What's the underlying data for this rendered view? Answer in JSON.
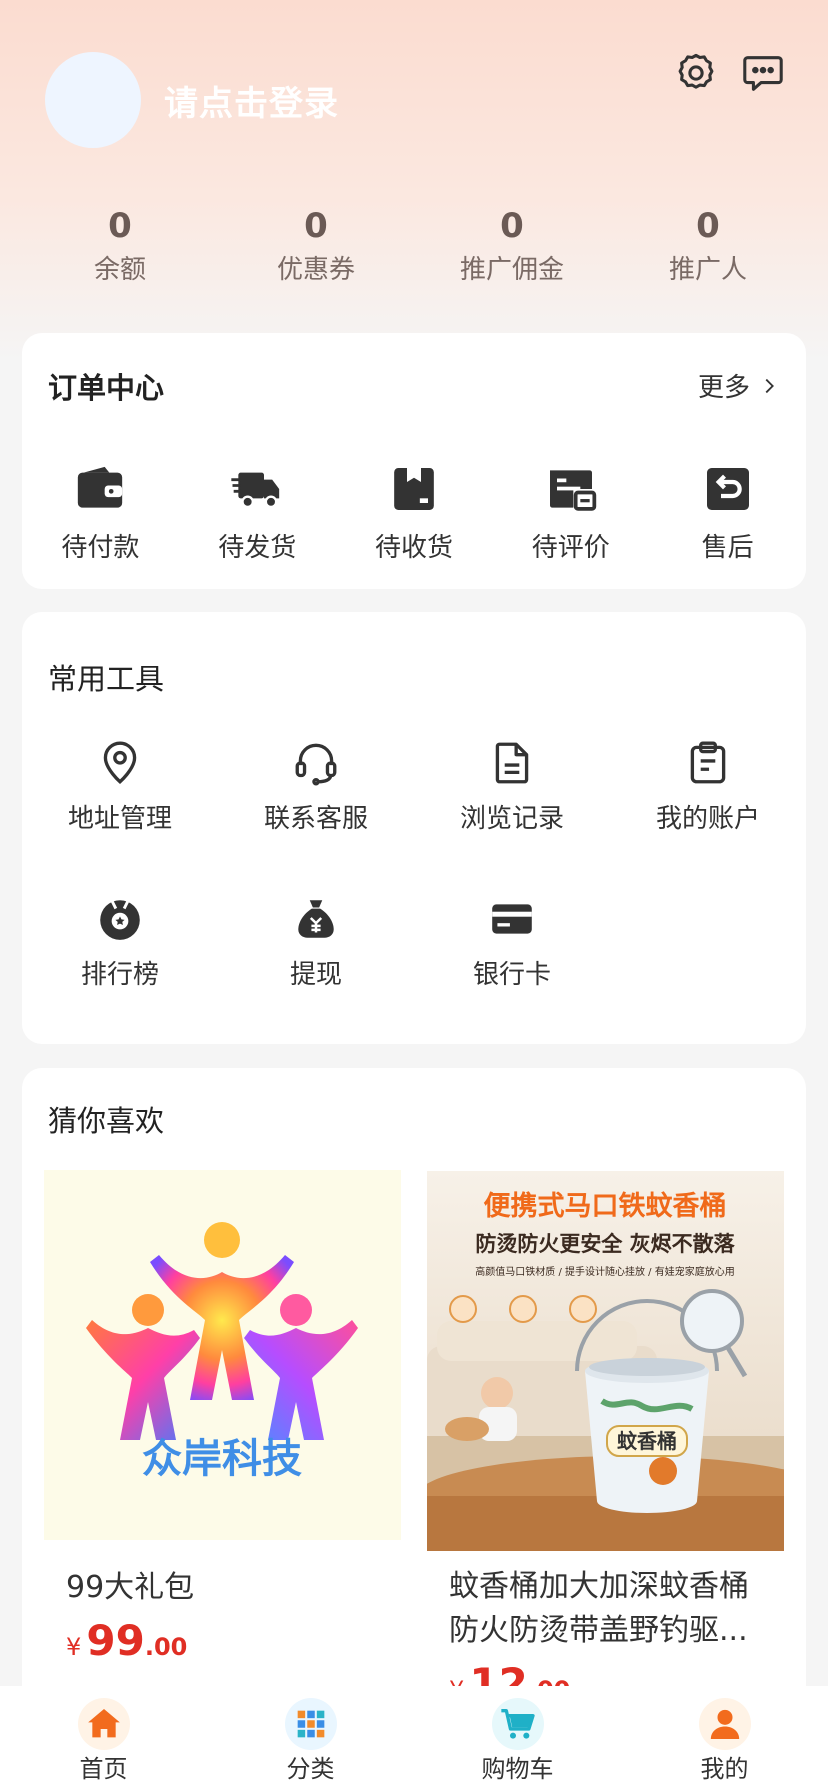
{
  "header": {
    "login_text": "请点击登录",
    "settings_icon": "gear-icon",
    "message_icon": "chat-bubble-icon"
  },
  "stats": [
    {
      "value": "0",
      "label": "余额"
    },
    {
      "value": "0",
      "label": "优惠券"
    },
    {
      "value": "0",
      "label": "推广佣金"
    },
    {
      "value": "0",
      "label": "推广人"
    }
  ],
  "orders": {
    "title": "订单中心",
    "more": "更多",
    "items": [
      {
        "label": "待付款",
        "icon": "wallet-icon"
      },
      {
        "label": "待发货",
        "icon": "delivery-truck-icon"
      },
      {
        "label": "待收货",
        "icon": "package-icon"
      },
      {
        "label": "待评价",
        "icon": "review-icon"
      },
      {
        "label": "售后",
        "icon": "return-icon"
      }
    ]
  },
  "tools": {
    "title": "常用工具",
    "items": [
      {
        "label": "地址管理",
        "icon": "location-pin-icon"
      },
      {
        "label": "联系客服",
        "icon": "headset-icon"
      },
      {
        "label": "浏览记录",
        "icon": "document-icon"
      },
      {
        "label": "我的账户",
        "icon": "clipboard-icon"
      },
      {
        "label": "排行榜",
        "icon": "medal-icon"
      },
      {
        "label": "提现",
        "icon": "money-bag-icon"
      },
      {
        "label": "银行卡",
        "icon": "bank-card-icon"
      }
    ]
  },
  "guess": {
    "title": "猜你喜欢",
    "products": [
      {
        "name": "99大礼包",
        "currency": "¥",
        "price_int": "99",
        "price_dec": ".00",
        "logo_text": "众岸科技"
      },
      {
        "name": "蚊香桶加大加深蚊香桶防火防烫带盖野钓驱...",
        "currency": "¥",
        "price_int": "12",
        "price_dec": ".00",
        "banner_title": "便携式马口铁蚊香桶",
        "banner_sub": "防烫防火更安全 灰烬不散落",
        "banner_small": "高颜值马口铁材质 / 提手设计随心挂放 / 有娃宠家庭放心用",
        "bucket_label": "蚊香桶"
      }
    ]
  },
  "tabbar": [
    {
      "label": "首页",
      "icon": "home-icon"
    },
    {
      "label": "分类",
      "icon": "category-grid-icon"
    },
    {
      "label": "购物车",
      "icon": "cart-icon"
    },
    {
      "label": "我的",
      "icon": "user-icon"
    }
  ],
  "colors": {
    "accent": "#e02e24",
    "header_top": "#fbdcd0",
    "home_orange": "#f26b1d"
  }
}
